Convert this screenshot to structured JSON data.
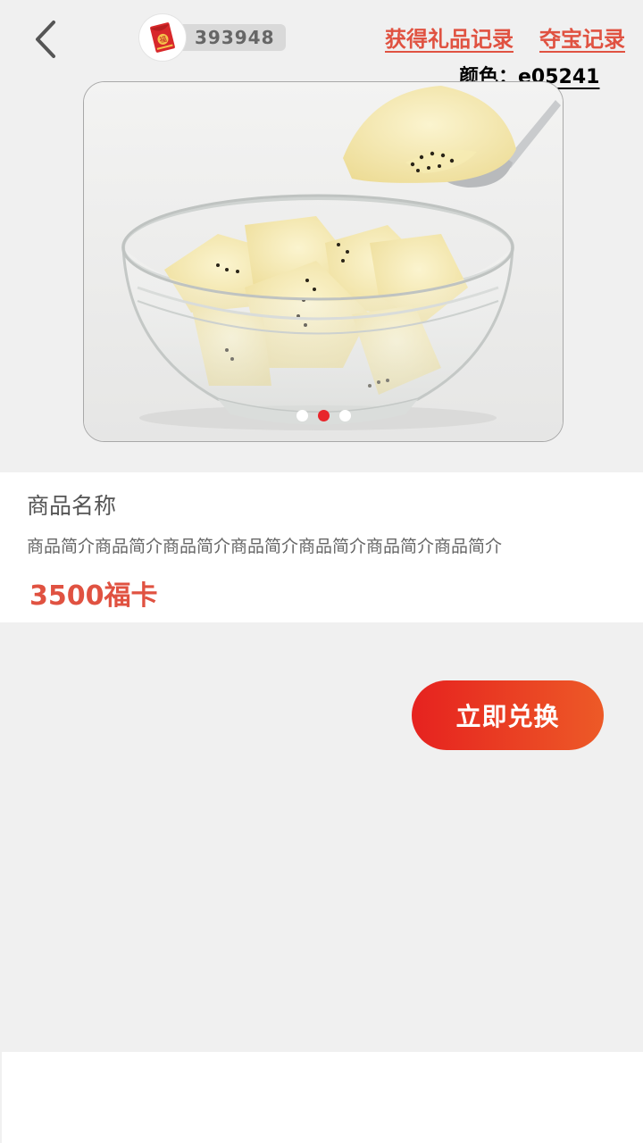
{
  "header": {
    "back_icon": "chevron-left-icon",
    "wallet": {
      "icon": "red-envelope-icon",
      "count": "393948"
    },
    "links": {
      "gift_records": "获得礼品记录",
      "treasure_records": "夺宝记录"
    },
    "color_label": "颜色：e05241"
  },
  "carousel": {
    "image": "kiwi-fruit-bowl-image",
    "slide_count": 3,
    "active_index": 1
  },
  "product": {
    "name": "商品名称",
    "description": "商品简介商品简介商品简介商品简介商品简介商品简介商品简介",
    "price": "3500福卡"
  },
  "actions": {
    "redeem_label": "立即兑换"
  },
  "colors": {
    "accent": "#e05241",
    "button_gradient_start": "#e6221f",
    "button_gradient_end": "#ed5a27",
    "active_dot": "#e8262b",
    "page_background": "#f0f0f0"
  }
}
